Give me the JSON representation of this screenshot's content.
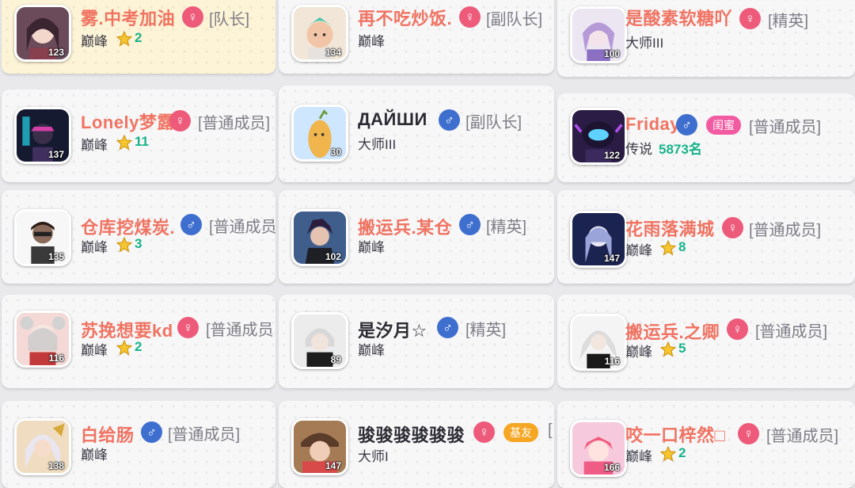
{
  "members": [
    {
      "name": "雾.中考加油",
      "gender": "female",
      "gender_icon": "♀",
      "role": "[队长]",
      "rank": "巅峰",
      "stars": "2",
      "level": "123",
      "leader": true
    },
    {
      "name": "再不吃炒饭.",
      "gender": "female",
      "gender_icon": "♀",
      "role": "[副队长]",
      "rank": "巅峰",
      "level": "134"
    },
    {
      "name": "是酸素软糖吖",
      "gender": "female",
      "gender_icon": "♀",
      "role": "[精英]",
      "rank": "大师III",
      "level": "100"
    },
    {
      "name": "Lonely梦露",
      "gender": "female",
      "gender_icon": "♀",
      "role": "[普通成员]",
      "rank": "巅峰",
      "stars": "11",
      "level": "137"
    },
    {
      "name": "ДАЙШИ",
      "gender": "male",
      "gender_icon": "♂",
      "role": "[副队长]",
      "rank": "大师III",
      "level": "30"
    },
    {
      "name": "Friday",
      "gender": "male",
      "gender_icon": "♂",
      "tag": "闺蜜",
      "role": "[普通成员]",
      "rank": "传说",
      "position": "5873名",
      "level": "122"
    },
    {
      "name": "仓库挖煤炭.",
      "gender": "male",
      "gender_icon": "♂",
      "role": "[普通成员",
      "rank": "巅峰",
      "stars": "3",
      "level": "135"
    },
    {
      "name": "搬运兵.某仓",
      "gender": "male",
      "gender_icon": "♂",
      "role": "[精英]",
      "rank": "巅峰",
      "level": "102"
    },
    {
      "name": "花雨落满城",
      "gender": "female",
      "gender_icon": "♀",
      "role": "[普通成员]",
      "rank": "巅峰",
      "stars": "8",
      "level": "147"
    },
    {
      "name": "苏挽想要kd",
      "gender": "female",
      "gender_icon": "♀",
      "role": "[普通成员",
      "rank": "巅峰",
      "stars": "2",
      "level": "116"
    },
    {
      "name": "是汐月☆",
      "gender": "male",
      "gender_icon": "♂",
      "role": "[精英]",
      "rank": "巅峰",
      "level": "89"
    },
    {
      "name": "搬运兵.之卿",
      "gender": "female",
      "gender_icon": "♀",
      "role": "[普通成员]",
      "rank": "巅峰",
      "stars": "5",
      "level": "116"
    },
    {
      "name": "白给肠",
      "gender": "male",
      "gender_icon": "♂",
      "role": "[普通成员]",
      "rank": "巅峰",
      "level": "138"
    },
    {
      "name": "骏骏骏骏骏骏",
      "gender": "female",
      "gender_icon": "♀",
      "tag": "基友",
      "role": "[",
      "rank": "大师I",
      "level": "147"
    },
    {
      "name": "咬一口梓然□",
      "gender": "female",
      "gender_icon": "♀",
      "role": "[普通成员]",
      "rank": "巅峰",
      "stars": "2",
      "level": "166"
    }
  ],
  "colors": {
    "name_accent": "#f07362",
    "female": "#ee5a7a",
    "male": "#3e6fcf",
    "star_count": "#17b38a",
    "tag_pink": "#f25aa1",
    "tag_orange": "#f5a623"
  }
}
